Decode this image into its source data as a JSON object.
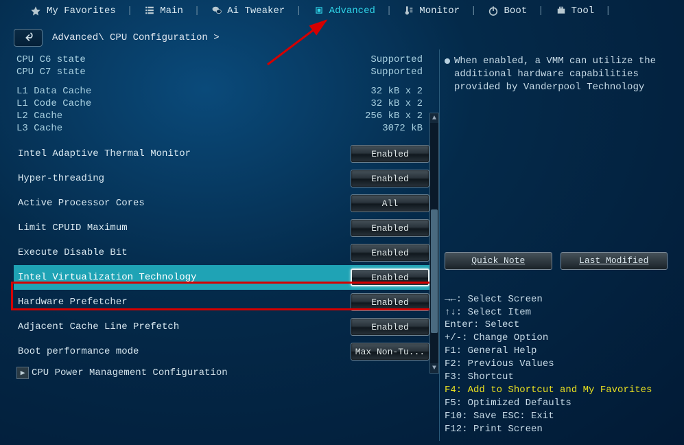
{
  "nav": {
    "favorites": "My Favorites",
    "main": "Main",
    "ai_tweaker": "Ai Tweaker",
    "advanced": "Advanced",
    "monitor": "Monitor",
    "boot": "Boot",
    "tool": "Tool"
  },
  "breadcrumb": "Advanced\\ CPU Configuration >",
  "info": {
    "c6_label": "CPU C6 state",
    "c6_value": "Supported",
    "c7_label": "CPU C7 state",
    "c7_value": "Supported",
    "l1d_label": "L1 Data Cache",
    "l1d_value": "32 kB x 2",
    "l1c_label": "L1 Code Cache",
    "l1c_value": "32 kB x 2",
    "l2_label": "L2 Cache",
    "l2_value": "256 kB x 2",
    "l3_label": "L3 Cache",
    "l3_value": "3072 kB"
  },
  "settings": {
    "thermal": {
      "label": "Intel Adaptive Thermal Monitor",
      "value": "Enabled"
    },
    "ht": {
      "label": "Hyper-threading",
      "value": "Enabled"
    },
    "cores": {
      "label": "Active Processor Cores",
      "value": "All"
    },
    "cpuid": {
      "label": "Limit CPUID Maximum",
      "value": "Enabled"
    },
    "xd": {
      "label": "Execute Disable Bit",
      "value": "Enabled"
    },
    "vt": {
      "label": "Intel Virtualization Technology",
      "value": "Enabled"
    },
    "hwpf": {
      "label": "Hardware Prefetcher",
      "value": "Enabled"
    },
    "aclp": {
      "label": "Adjacent Cache Line Prefetch",
      "value": "Enabled"
    },
    "boot_perf": {
      "label": "Boot performance mode",
      "value": "Max Non-Tu..."
    },
    "cpupm": {
      "label": "CPU Power Management Configuration"
    }
  },
  "help_text": "When enabled, a VMM can utilize the additional hardware capabilities provided by Vanderpool Technology",
  "right_buttons": {
    "quicknote": "Quick Note",
    "lastmod": "Last Modified"
  },
  "shortcuts": {
    "s1": "→←: Select Screen",
    "s2": "↑↓: Select Item",
    "s3": "Enter: Select",
    "s4": "+/-: Change Option",
    "s5": "F1: General Help",
    "s6": "F2: Previous Values",
    "s7": "F3: Shortcut",
    "s8": "F4: Add to Shortcut and My Favorites",
    "s9": "F5: Optimized Defaults",
    "s10": "F10: Save  ESC: Exit",
    "s11": "F12: Print Screen"
  }
}
